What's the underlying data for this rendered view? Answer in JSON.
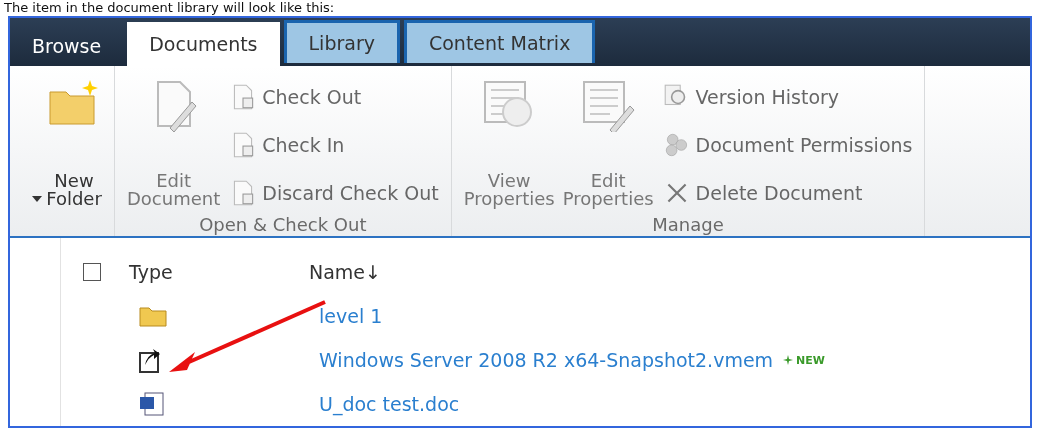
{
  "caption": "The item in the document library will look like this:",
  "tabs": [
    {
      "label": "Browse",
      "kind": "standard",
      "selected": false
    },
    {
      "label": "Documents",
      "kind": "standard",
      "selected": true
    },
    {
      "label": "Library",
      "kind": "contextual",
      "selected": false
    },
    {
      "label": "Content Matrix",
      "kind": "contextual",
      "selected": false
    }
  ],
  "groups": [
    {
      "buttons": [
        {
          "label": "New Folder",
          "kind": "large",
          "disabled": false,
          "dropdown": true
        }
      ]
    },
    {
      "label": "Open & Check Out",
      "buttons": [
        {
          "label": "Edit Document",
          "kind": "large",
          "disabled": true
        },
        {
          "label": "Check Out",
          "kind": "small",
          "disabled": true
        },
        {
          "label": "Check In",
          "kind": "small",
          "disabled": true
        },
        {
          "label": "Discard Check Out",
          "kind": "small",
          "disabled": true
        }
      ]
    },
    {
      "label": "Manage",
      "buttons": [
        {
          "label": "View Properties",
          "kind": "large",
          "disabled": true
        },
        {
          "label": "Edit Properties",
          "kind": "large",
          "disabled": true
        },
        {
          "label": "Version History",
          "kind": "small",
          "disabled": true
        },
        {
          "label": "Document Permissions",
          "kind": "small",
          "disabled": true
        },
        {
          "label": "Delete Document",
          "kind": "small",
          "disabled": true
        }
      ]
    }
  ],
  "list": {
    "select_all": {
      "checked": false
    },
    "columns": [
      "Type",
      "Name↓"
    ],
    "rows": [
      {
        "kind": "folder",
        "name": "level 1"
      },
      {
        "kind": "link",
        "name": "Windows Server 2008 R2 x64-Snapshot2.vmem",
        "badge": "NEW"
      },
      {
        "kind": "word",
        "name": "U_doc test.doc"
      }
    ]
  }
}
